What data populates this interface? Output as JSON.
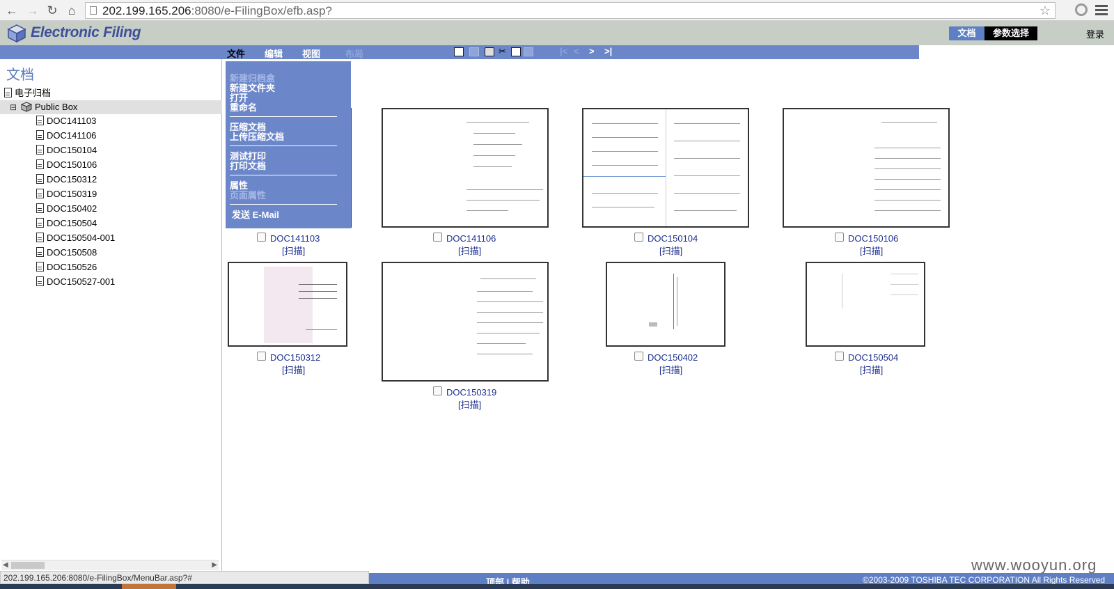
{
  "browser": {
    "url_host": "202.199.165.206",
    "url_rest": ":8080/e-FilingBox/efb.asp?"
  },
  "header": {
    "logo_text": "Electronic Filing",
    "tab_documents": "文档",
    "tab_params": "参数选择",
    "login": "登录"
  },
  "menubar": {
    "file": "文件",
    "edit": "编辑",
    "view": "视图",
    "layout": "布局",
    "nav_first": "|<",
    "nav_prev": "<",
    "nav_next": ">",
    "nav_last": ">|"
  },
  "dropdown": {
    "new_box": "新建归档盒",
    "new_folder": "新建文件夹",
    "open": "打开",
    "rename": "重命名",
    "compress": "压缩文档",
    "upload_compressed": "上传压缩文档",
    "test_print": "测试打印",
    "print_doc": "打印文档",
    "properties": "属性",
    "page_properties": "页面属性",
    "send_email": "发送 E-Mail"
  },
  "tree": {
    "title": "文档",
    "root": "电子归档",
    "box": "Public Box",
    "toggle": "⊟",
    "docs": [
      "DOC141103",
      "DOC141106",
      "DOC150104",
      "DOC150106",
      "DOC150312",
      "DOC150319",
      "DOC150402",
      "DOC150504",
      "DOC150504-001",
      "DOC150508",
      "DOC150526",
      "DOC150527-001"
    ]
  },
  "thumbnails": [
    {
      "name": "DOC141103",
      "scan": "[扫描]"
    },
    {
      "name": "DOC141106",
      "scan": "[扫描]"
    },
    {
      "name": "DOC150104",
      "scan": "[扫描]"
    },
    {
      "name": "DOC150106",
      "scan": "[扫描]"
    },
    {
      "name": "DOC150312",
      "scan": "[扫描]"
    },
    {
      "name": "DOC150319",
      "scan": "[扫描]"
    },
    {
      "name": "DOC150402",
      "scan": "[扫描]"
    },
    {
      "name": "DOC150504",
      "scan": "[扫描]"
    }
  ],
  "footer": {
    "links": "顶部 | 帮助",
    "copyright": "©2003-2009 TOSHIBA TEC CORPORATION All Rights Reserved",
    "status_url": "202.199.165.206:8080/e-FilingBox/MenuBar.asp?#",
    "watermark": "www.wooyun.org"
  },
  "colors": {
    "menu_blue": "#6b87c9",
    "header_gray": "#c6cec6",
    "link_blue": "#1d2f8f"
  }
}
